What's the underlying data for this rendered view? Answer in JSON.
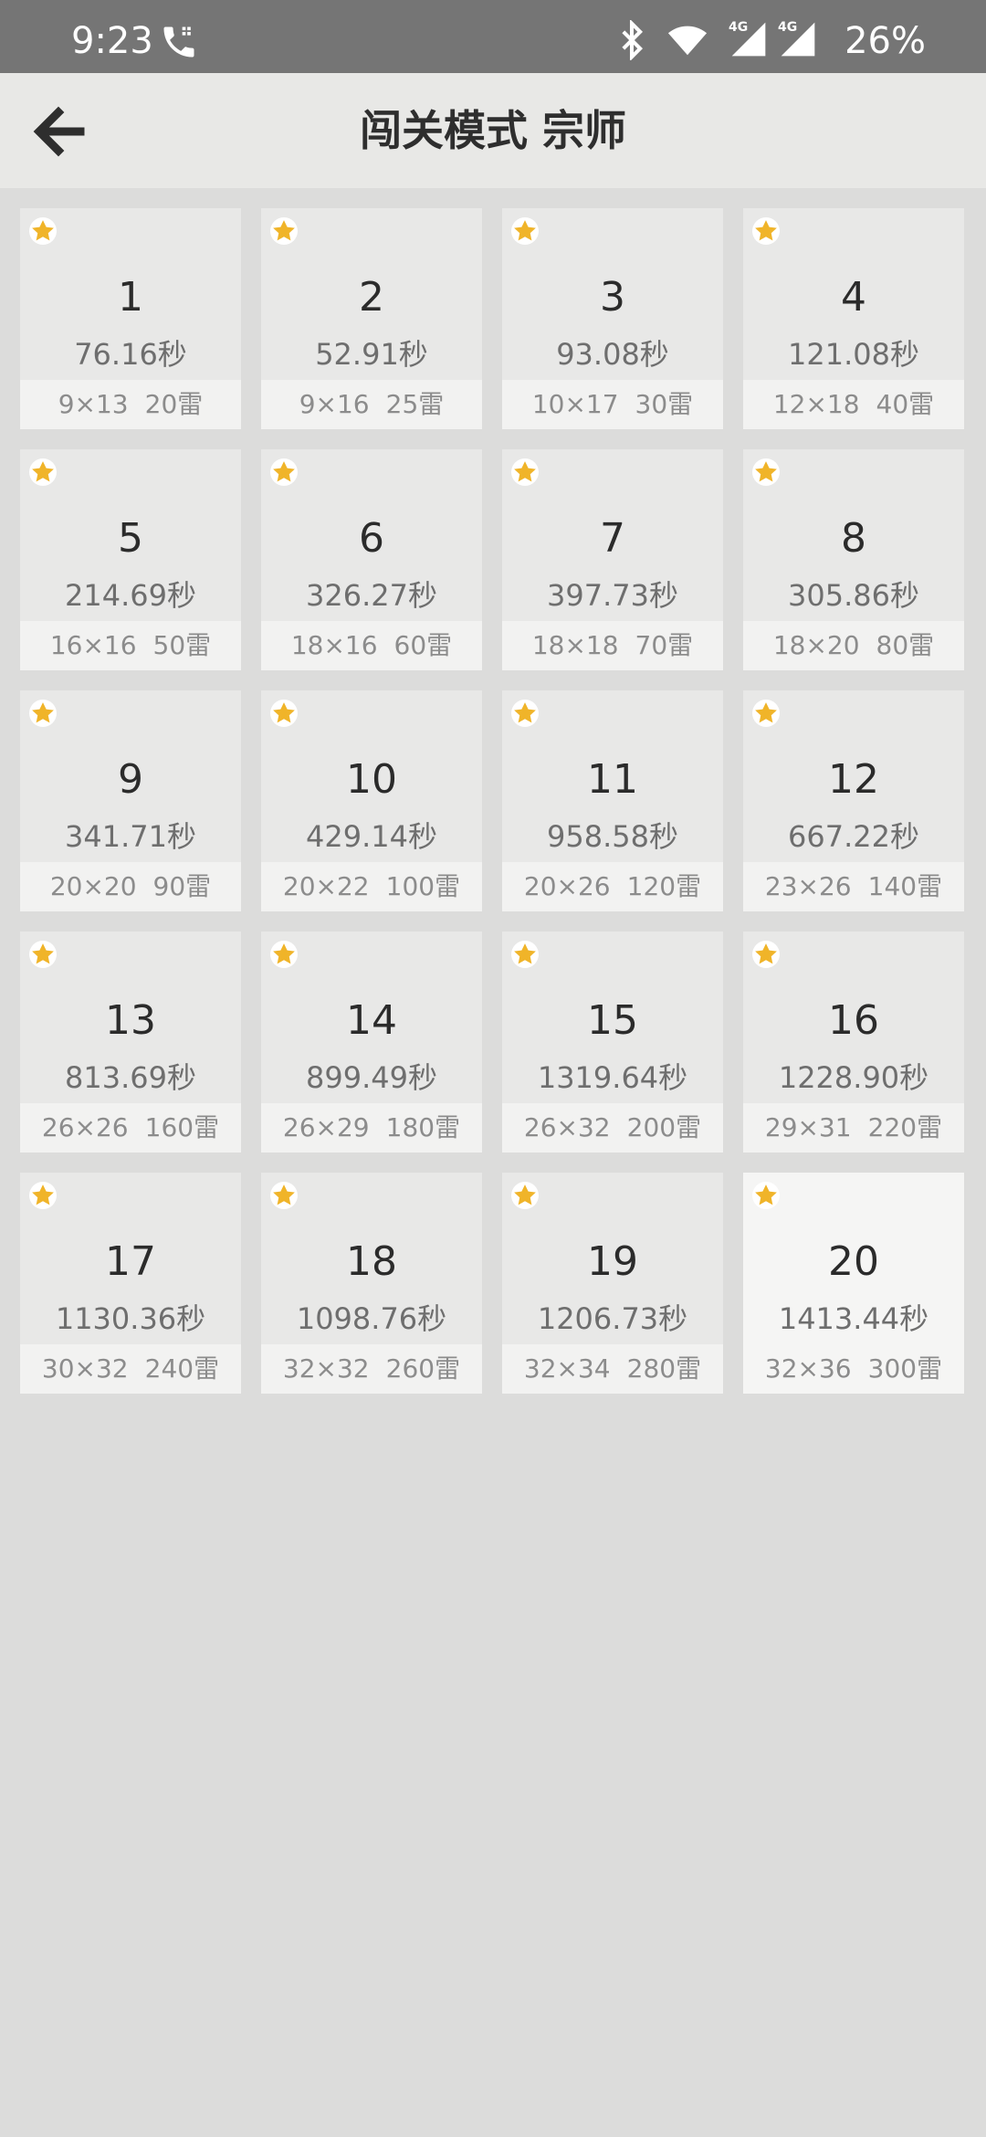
{
  "status_bar": {
    "time": "9:23",
    "battery": "26%",
    "network_1": "4G",
    "network_2": "4G",
    "icons": [
      "phone-call-icon",
      "bluetooth-icon",
      "wifi-icon",
      "signal-icon",
      "signal-icon"
    ]
  },
  "header": {
    "title": "闯关模式 宗师",
    "back_icon": "arrow-left-icon"
  },
  "colors": {
    "star": "#f0b429",
    "status_bar": "#757575",
    "app_bar": "#e8e8e6",
    "background": "#dcdcdb"
  },
  "levels": [
    {
      "number": "1",
      "time": "76.16秒",
      "size": "9×13",
      "mines": "20雷",
      "starred": true
    },
    {
      "number": "2",
      "time": "52.91秒",
      "size": "9×16",
      "mines": "25雷",
      "starred": true
    },
    {
      "number": "3",
      "time": "93.08秒",
      "size": "10×17",
      "mines": "30雷",
      "starred": true
    },
    {
      "number": "4",
      "time": "121.08秒",
      "size": "12×18",
      "mines": "40雷",
      "starred": true
    },
    {
      "number": "5",
      "time": "214.69秒",
      "size": "16×16",
      "mines": "50雷",
      "starred": true
    },
    {
      "number": "6",
      "time": "326.27秒",
      "size": "18×16",
      "mines": "60雷",
      "starred": true
    },
    {
      "number": "7",
      "time": "397.73秒",
      "size": "18×18",
      "mines": "70雷",
      "starred": true
    },
    {
      "number": "8",
      "time": "305.86秒",
      "size": "18×20",
      "mines": "80雷",
      "starred": true
    },
    {
      "number": "9",
      "time": "341.71秒",
      "size": "20×20",
      "mines": "90雷",
      "starred": true
    },
    {
      "number": "10",
      "time": "429.14秒",
      "size": "20×22",
      "mines": "100雷",
      "starred": true
    },
    {
      "number": "11",
      "time": "958.58秒",
      "size": "20×26",
      "mines": "120雷",
      "starred": true
    },
    {
      "number": "12",
      "time": "667.22秒",
      "size": "23×26",
      "mines": "140雷",
      "starred": true
    },
    {
      "number": "13",
      "time": "813.69秒",
      "size": "26×26",
      "mines": "160雷",
      "starred": true
    },
    {
      "number": "14",
      "time": "899.49秒",
      "size": "26×29",
      "mines": "180雷",
      "starred": true
    },
    {
      "number": "15",
      "time": "1319.64秒",
      "size": "26×32",
      "mines": "200雷",
      "starred": true
    },
    {
      "number": "16",
      "time": "1228.90秒",
      "size": "29×31",
      "mines": "220雷",
      "starred": true
    },
    {
      "number": "17",
      "time": "1130.36秒",
      "size": "30×32",
      "mines": "240雷",
      "starred": true
    },
    {
      "number": "18",
      "time": "1098.76秒",
      "size": "32×32",
      "mines": "260雷",
      "starred": true
    },
    {
      "number": "19",
      "time": "1206.73秒",
      "size": "32×34",
      "mines": "280雷",
      "starred": true
    },
    {
      "number": "20",
      "time": "1413.44秒",
      "size": "32×36",
      "mines": "300雷",
      "starred": true,
      "current": true
    }
  ]
}
